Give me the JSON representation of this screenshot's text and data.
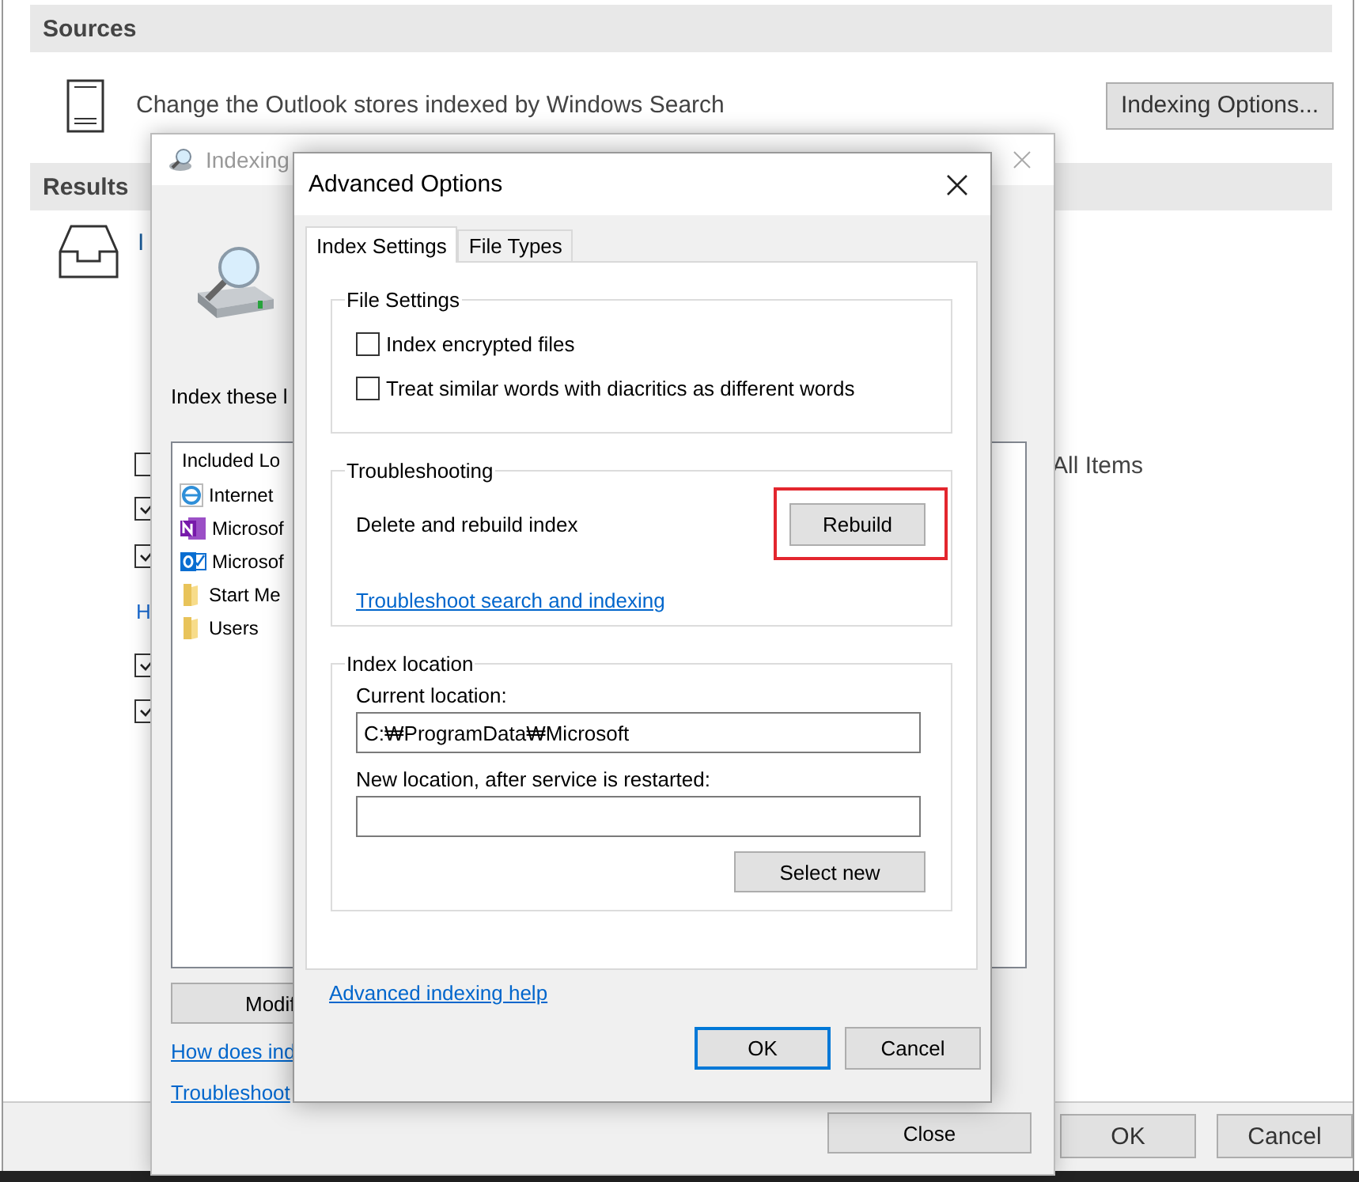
{
  "background_window": {
    "sources_header": "Sources",
    "sources_text": "Change the Outlook stores indexed by Windows Search",
    "indexing_options_button": "Indexing Options...",
    "results_header": "Results",
    "results_text": "I",
    "checkboxes_top": [
      {
        "checked": false
      },
      {
        "checked": true
      },
      {
        "checked": true
      }
    ],
    "link_fragment": "H",
    "checkboxes_bottom": [
      {
        "checked": true
      },
      {
        "checked": true
      }
    ],
    "all_items_text": "All Items",
    "buttons": [
      {
        "label": "OK"
      },
      {
        "label": "Cancel"
      }
    ]
  },
  "indexing_window": {
    "title": "Indexing",
    "prompt": "Index these l",
    "list_header": "Included Lo",
    "locations": [
      {
        "kind": "ie",
        "label": "Internet"
      },
      {
        "kind": "onenote",
        "label": "Microsof"
      },
      {
        "kind": "outlook",
        "label": "Microsof"
      },
      {
        "kind": "folder",
        "label": "Start Me"
      },
      {
        "kind": "folder",
        "label": "Users"
      }
    ],
    "modify_button": "Modif",
    "links": [
      "How does ind",
      "Troubleshoot"
    ],
    "close_button": "Close"
  },
  "advanced_dialog": {
    "title": "Advanced Options",
    "tabs": [
      {
        "label": "Index Settings",
        "selected": true
      },
      {
        "label": "File Types",
        "selected": false
      }
    ],
    "file_settings": {
      "title": "File Settings",
      "options": [
        {
          "label": "Index encrypted files",
          "checked": false
        },
        {
          "label": "Treat similar words with diacritics as different words",
          "checked": false
        }
      ]
    },
    "troubleshooting": {
      "title": "Troubleshooting",
      "text": "Delete and rebuild index",
      "button": "Rebuild",
      "highlighted": true,
      "link": "Troubleshoot search and indexing"
    },
    "index_location": {
      "title": "Index location",
      "current_label": "Current location:",
      "current_value": "C:₩ProgramData₩Microsoft",
      "new_label": "New location, after service is restarted:",
      "button": "Select new"
    },
    "help_link": "Advanced indexing help",
    "buttons": [
      {
        "label": "OK",
        "default": true
      },
      {
        "label": "Cancel",
        "default": false
      }
    ]
  }
}
